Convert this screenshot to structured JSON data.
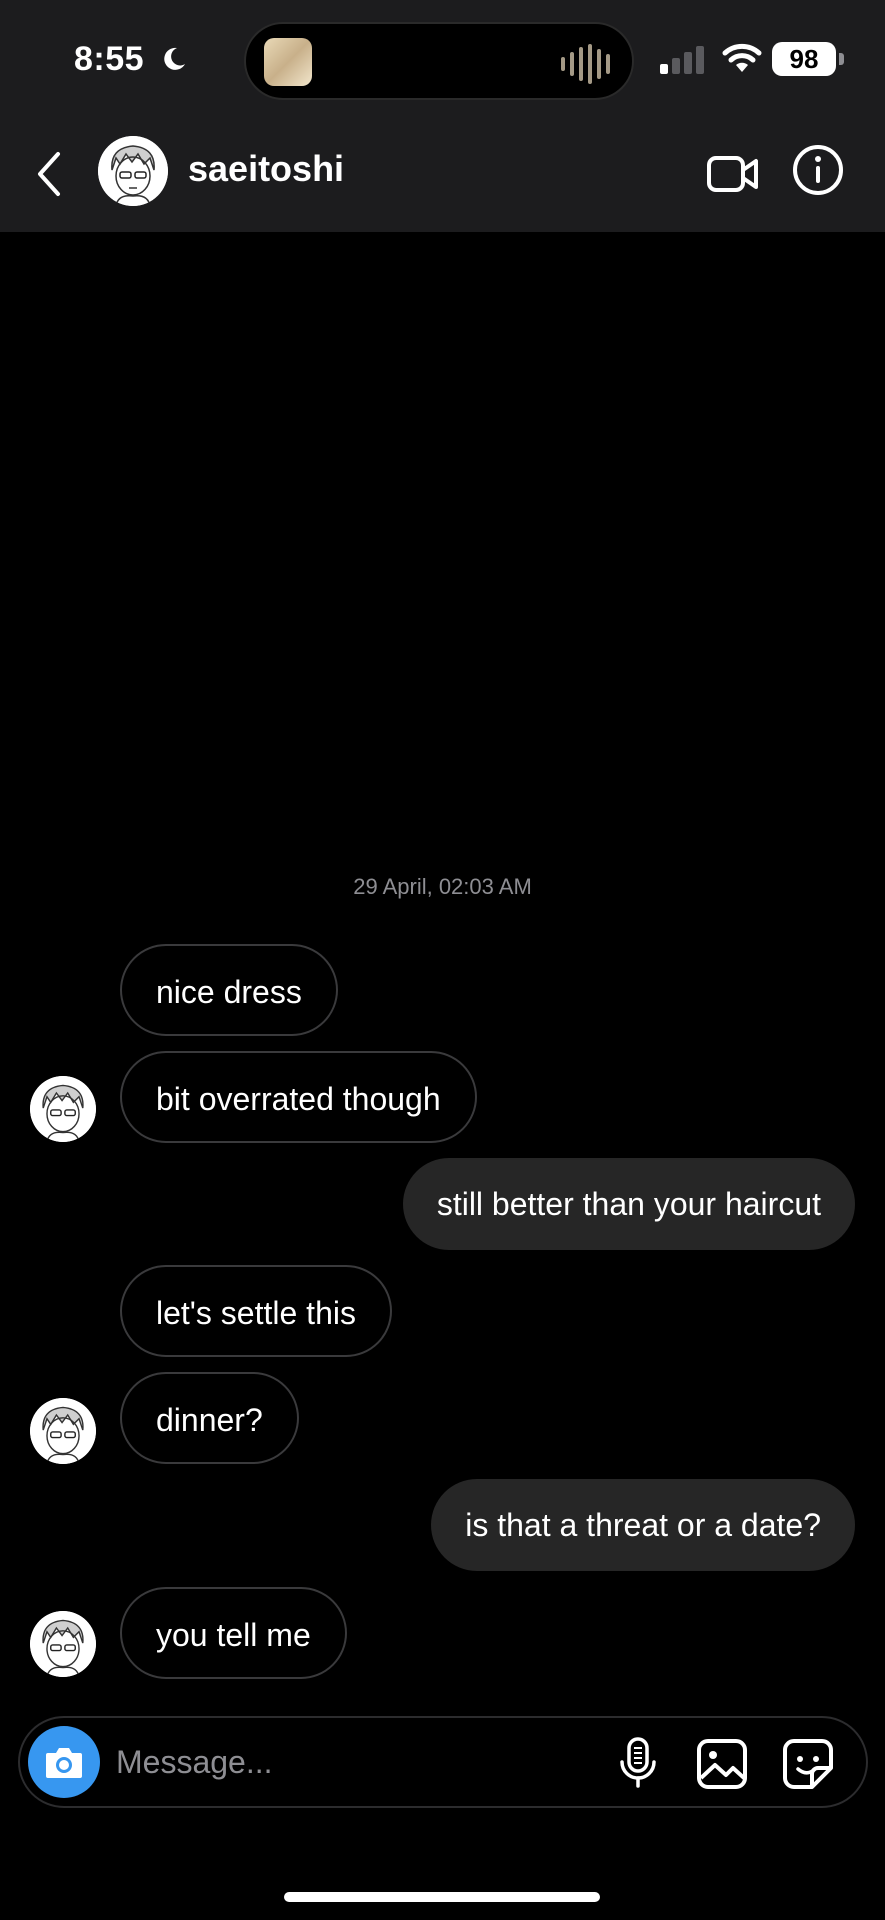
{
  "status_bar": {
    "time": "8:55",
    "battery": "98"
  },
  "header": {
    "username": "saeitoshi"
  },
  "thread": {
    "timestamp": "29 April, 02:03 AM",
    "messages": [
      {
        "from": "them",
        "text": "nice dress"
      },
      {
        "from": "them",
        "text": "bit overrated though"
      },
      {
        "from": "me",
        "text": "still better than your haircut"
      },
      {
        "from": "them",
        "text": "let's settle this"
      },
      {
        "from": "them",
        "text": "dinner?"
      },
      {
        "from": "me",
        "text": "is that a threat or a date?"
      },
      {
        "from": "them",
        "text": "you tell me"
      }
    ]
  },
  "composer": {
    "placeholder": "Message..."
  },
  "colors": {
    "accent": "#3797f0",
    "outgoing_bubble": "#262626",
    "header_bg": "#1c1c1e"
  },
  "icons": [
    "moon-icon",
    "signal-icon",
    "wifi-icon",
    "battery-icon",
    "back-chevron-icon",
    "video-call-icon",
    "info-icon",
    "camera-icon",
    "microphone-icon",
    "gallery-icon",
    "sticker-icon"
  ]
}
